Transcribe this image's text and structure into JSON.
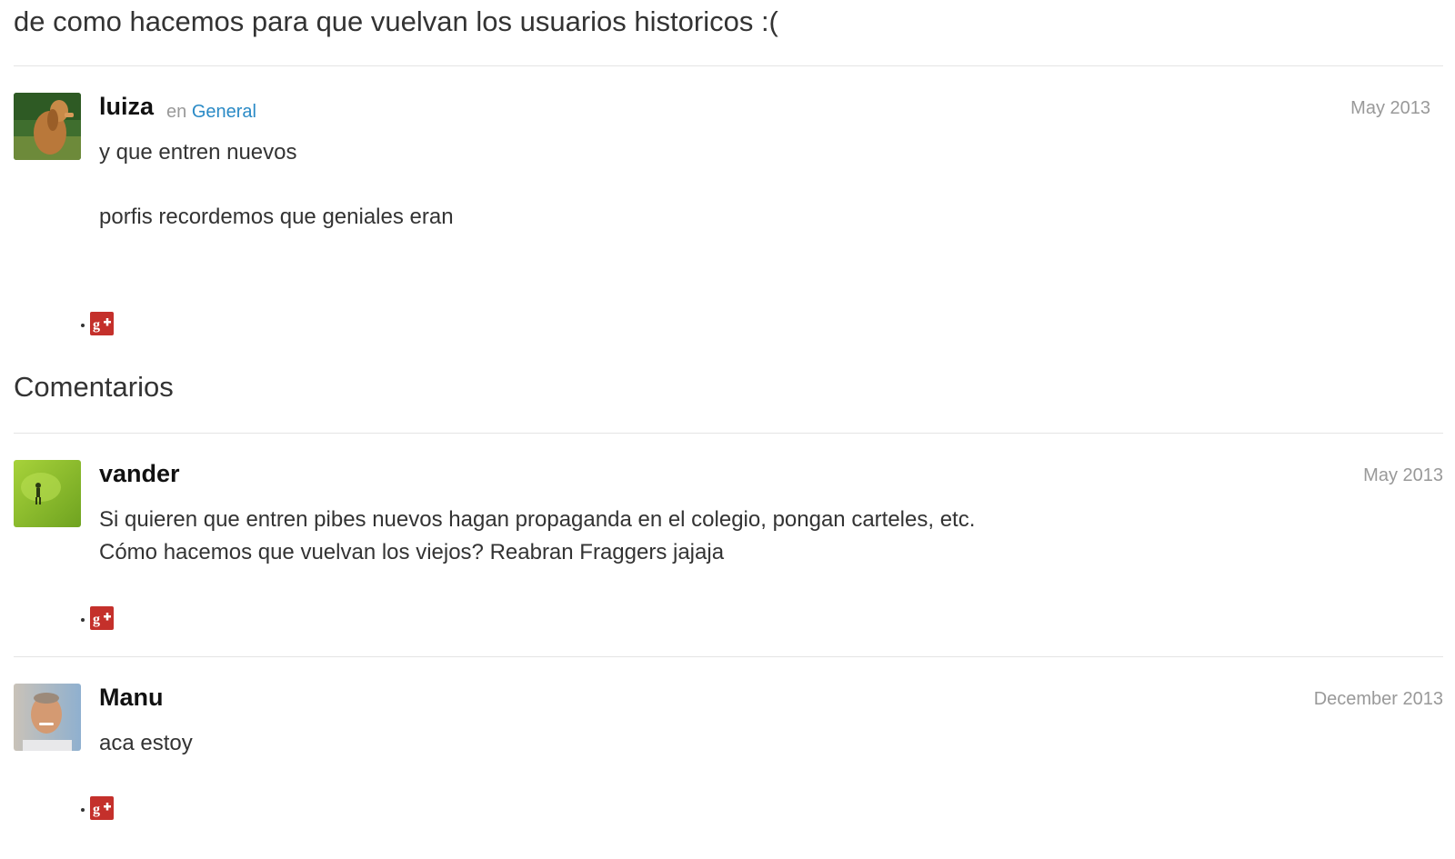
{
  "thread": {
    "title": "de como hacemos para que vuelvan los usuarios historicos :("
  },
  "original_post": {
    "author": "luiza",
    "category_prefix": "en",
    "category": "General",
    "date": "May 2013",
    "body": [
      "y que entren nuevos",
      "porfis recordemos que geniales eran"
    ],
    "avatar_icon": "dog-photo-avatar"
  },
  "comments_section": {
    "title": "Comentarios"
  },
  "comments": [
    {
      "author": "vander",
      "date": "May 2013",
      "body": [
        "Si quieren que entren pibes nuevos hagan propaganda en el colegio, pongan carteles, etc.",
        "Cómo hacemos que vuelvan los viejos? Reabran Fraggers jajaja"
      ],
      "avatar_icon": "runner-photo-avatar"
    },
    {
      "author": "Manu",
      "date": "December 2013",
      "body": [
        "aca estoy"
      ],
      "avatar_icon": "man-photo-avatar"
    }
  ],
  "share": {
    "icon": "google-plus-icon",
    "color": "#c4302b"
  },
  "colors": {
    "link": "#2a8ac6",
    "muted": "#999999",
    "divider": "#e4e4e4"
  }
}
